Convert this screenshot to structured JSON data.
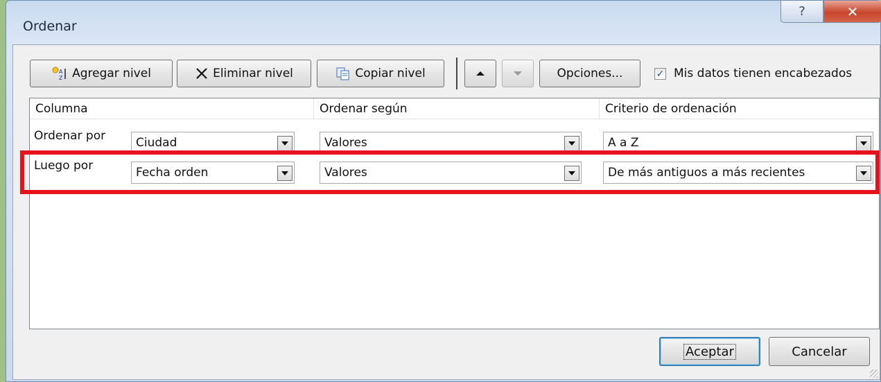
{
  "window": {
    "title": "Ordenar",
    "help_glyph": "?",
    "close_glyph": "✕"
  },
  "toolbar": {
    "add_level": "Agregar nivel",
    "delete_level": "Eliminar nivel",
    "copy_level": "Copiar nivel",
    "options": "Opciones...",
    "headers_checkbox_label": "Mis datos tienen encabezados",
    "headers_checked": true
  },
  "grid": {
    "headers": [
      "Columna",
      "Ordenar según",
      "Criterio de ordenación"
    ],
    "rows": [
      {
        "label": "Ordenar por",
        "column": "Ciudad",
        "sort_on": "Valores",
        "order": "A a Z"
      },
      {
        "label": "Luego por",
        "column": "Fecha orden",
        "sort_on": "Valores",
        "order": "De más antiguos a más recientes"
      }
    ]
  },
  "buttons": {
    "ok": "Aceptar",
    "cancel": "Cancelar"
  },
  "colors": {
    "highlight": "#e8121c",
    "background": "#9fc089"
  },
  "icons": [
    "add-level-icon",
    "delete-x-icon",
    "copy-icon",
    "move-up-icon",
    "move-down-icon",
    "checkbox-check-icon",
    "dropdown-arrow-icon"
  ]
}
